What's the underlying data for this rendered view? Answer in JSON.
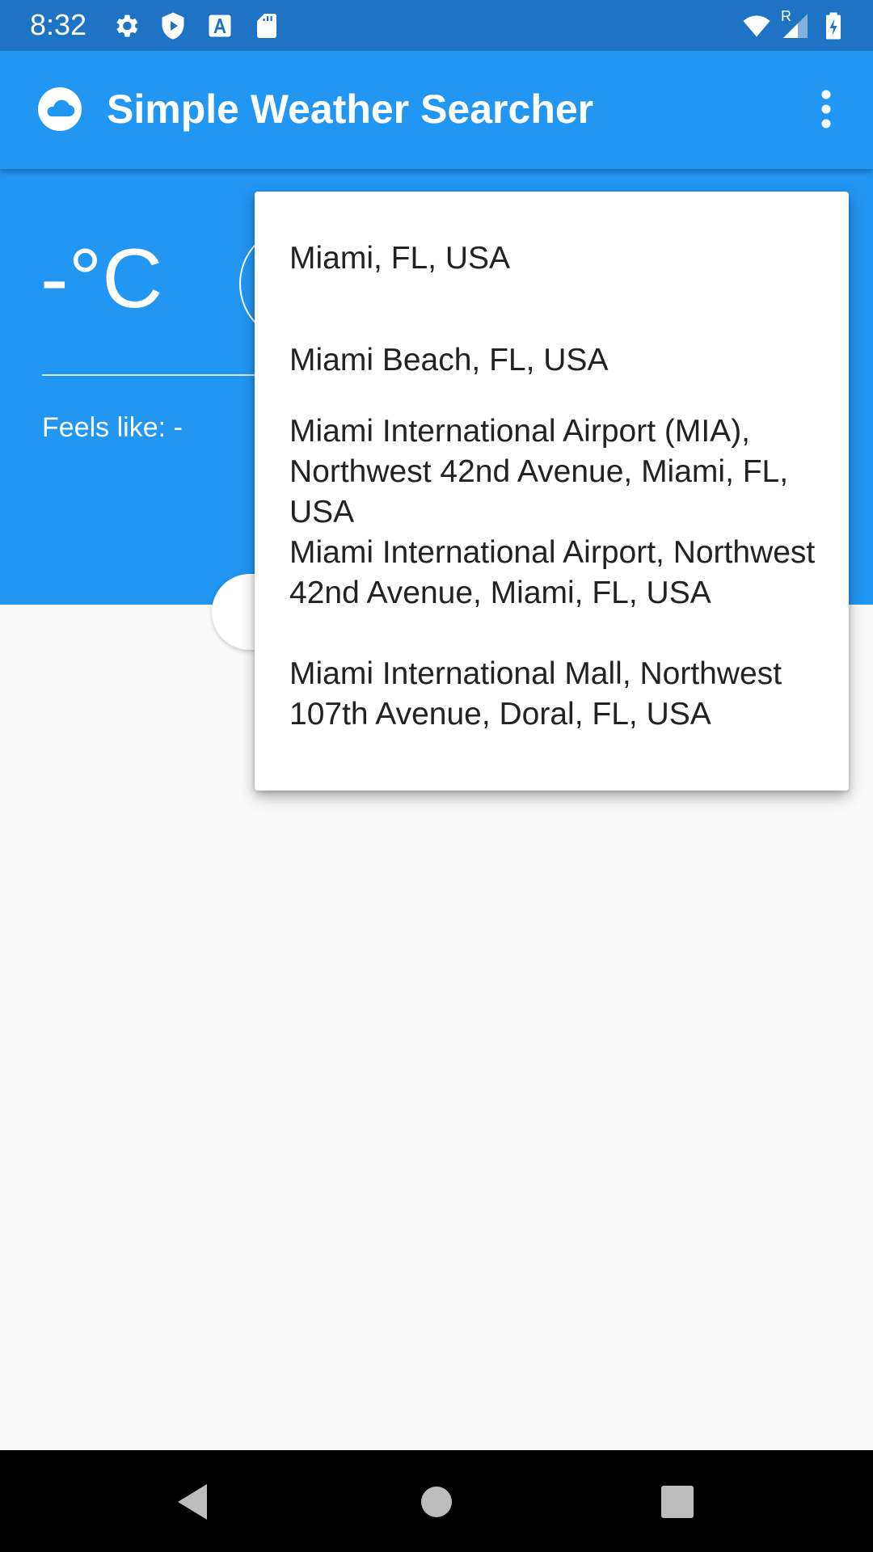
{
  "status_bar": {
    "time": "8:32",
    "icons": [
      "settings-icon",
      "shield-play-icon",
      "font-download-icon",
      "sd-card-icon",
      "wifi-icon",
      "signal-icon",
      "battery-charging-icon"
    ],
    "roaming_letter": "R"
  },
  "app_bar": {
    "title": "Simple Weather Searcher",
    "logo_icon": "cloud-icon",
    "menu_icon": "more-vertical-icon"
  },
  "weather": {
    "temperature": "-°C",
    "feels_like": "Feels like: -"
  },
  "suggestions": {
    "items": [
      "Miami, FL, USA",
      "Miami Beach, FL, USA",
      "Miami International Airport (MIA), Northwest 42nd Avenue, Miami, FL, USA",
      "Miami International Airport, Northwest 42nd Avenue, Miami, FL, USA",
      "Miami International Mall, Northwest 107th Avenue, Doral, FL, USA"
    ]
  },
  "nav_bar": {
    "icons": [
      "back-icon",
      "home-icon",
      "recents-icon"
    ]
  },
  "colors": {
    "status_bar": "#1e73c4",
    "primary": "#2196f3",
    "background": "#fafafa"
  }
}
